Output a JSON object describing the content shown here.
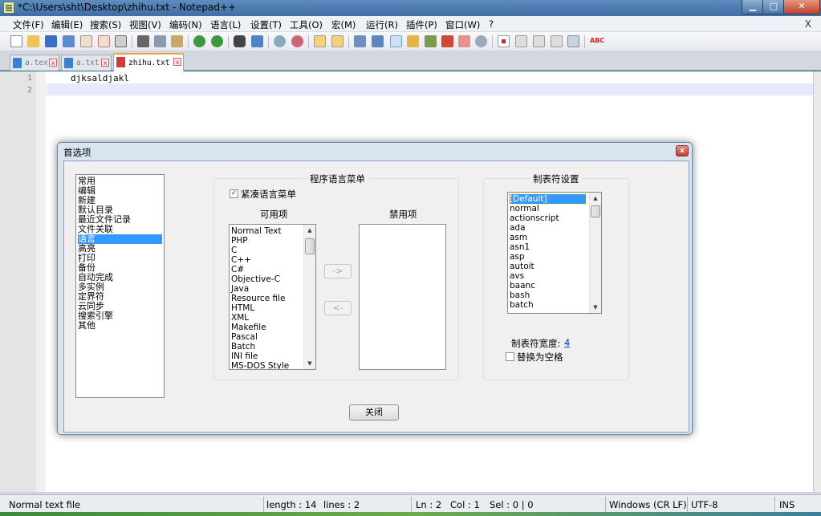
{
  "window": {
    "title": "*C:\\Users\\sht\\Desktop\\zhihu.txt - Notepad++",
    "min_label": "▁",
    "max_label": "□",
    "close_label": "✕"
  },
  "menu": {
    "items": [
      "文件(F)",
      "编辑(E)",
      "搜索(S)",
      "视图(V)",
      "编码(N)",
      "语言(L)",
      "设置(T)",
      "工具(O)",
      "宏(M)",
      "运行(R)",
      "插件(P)",
      "窗口(W)",
      "?"
    ],
    "close_label": "X"
  },
  "toolbar": {
    "icons": [
      "new-file-icon",
      "open-file-icon",
      "save-icon",
      "save-all-icon",
      "close-icon",
      "close-all-icon",
      "print-icon",
      "cut-icon",
      "copy-icon",
      "paste-icon",
      "undo-icon",
      "redo-icon",
      "find-icon",
      "replace-icon",
      "zoom-in-icon",
      "zoom-out-icon",
      "sync-vertical-icon",
      "sync-horizontal-icon",
      "word-wrap-icon",
      "show-all-chars-icon",
      "indent-guide-icon",
      "user-language-icon",
      "doc-map-icon",
      "function-list-icon",
      "folder-workspace-icon",
      "monitor-icon",
      "record-macro-icon",
      "stop-record-icon",
      "play-macro-icon",
      "run-macro-multiple-icon",
      "save-macro-icon",
      "spellcheck-icon"
    ]
  },
  "tabs": [
    {
      "label": "a.tex",
      "close": "x"
    },
    {
      "label": "a.txt",
      "close": "x"
    },
    {
      "label": "zhihu.txt",
      "close": "x"
    }
  ],
  "editor": {
    "lines": [
      {
        "num": "1",
        "text": "djksaldjakl"
      },
      {
        "num": "2",
        "text": ""
      }
    ]
  },
  "status": {
    "file_type": "Normal text file",
    "length": "length : 14",
    "lines": "lines : 2",
    "ln": "Ln : 2",
    "col": "Col : 1",
    "sel": "Sel : 0 | 0",
    "eol": "Windows (CR LF)",
    "encoding": "UTF-8",
    "mode": "INS"
  },
  "dialog": {
    "title": "首选项",
    "close_label": "x",
    "categories": [
      "常用",
      "编辑",
      "新建",
      "默认目录",
      "最近文件记录",
      "文件关联",
      "语言",
      "高亮",
      "打印",
      "备份",
      "自动完成",
      "多实例",
      "定界符",
      "云同步",
      "搜索引擎",
      "其他"
    ],
    "selected_category": "语言",
    "lang_menu": {
      "group_label": "程序语言菜单",
      "compact_label": "紧凑语言菜单",
      "compact_checked": "✓",
      "available_label": "可用项",
      "disabled_label": "禁用项",
      "available": [
        "Normal Text",
        "PHP",
        "C",
        "C++",
        "C#",
        "Objective-C",
        "Java",
        "Resource file",
        "HTML",
        "XML",
        "Makefile",
        "Pascal",
        "Batch",
        "INI file",
        "MS-DOS Style"
      ],
      "disabled": [],
      "add_button": "->",
      "remove_button": "<-"
    },
    "tab_settings": {
      "group_label": "制表符设置",
      "languages": [
        "[Default]",
        "normal",
        "actionscript",
        "ada",
        "asm",
        "asn1",
        "asp",
        "autoit",
        "avs",
        "baanc",
        "bash",
        "batch"
      ],
      "selected_language": "[Default]",
      "tab_size_label": "制表符宽度:",
      "tab_size_value": "4",
      "replace_spaces_label": "替换为空格",
      "replace_spaces_checked": ""
    },
    "close_button": "关闭"
  }
}
